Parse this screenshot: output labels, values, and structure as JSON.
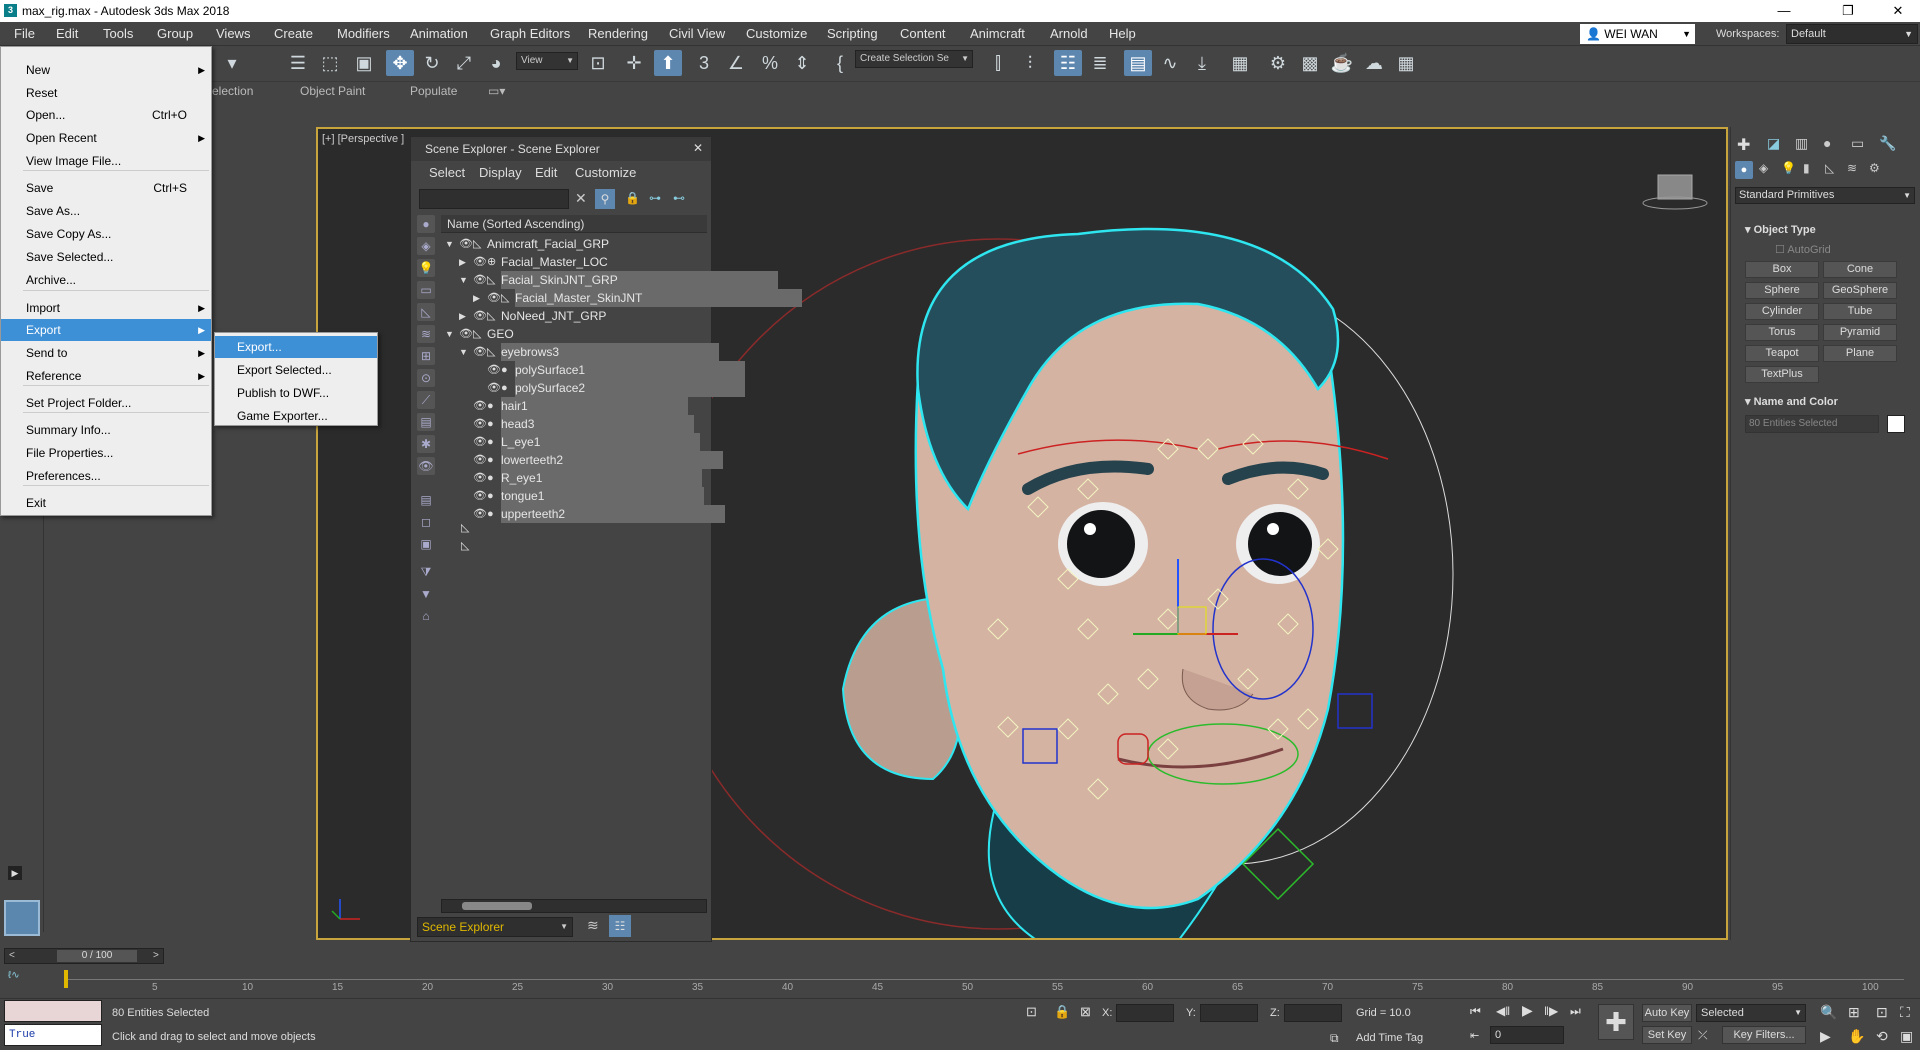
{
  "window": {
    "title": "max_rig.max - Autodesk 3ds Max 2018",
    "minimize": "—",
    "maximize": "❐",
    "close": "✕"
  },
  "menubar": [
    "File",
    "Edit",
    "Tools",
    "Group",
    "Views",
    "Create",
    "Modifiers",
    "Animation",
    "Graph Editors",
    "Rendering",
    "Civil View",
    "Customize",
    "Scripting",
    "Content",
    "Animcraft",
    "Arnold",
    "Help"
  ],
  "user": {
    "name": "WEI WAN"
  },
  "workspace": {
    "label": "Workspaces:",
    "value": "Default"
  },
  "toolbar": {
    "view_dropdown": "View",
    "selection_set": "Create Selection Se"
  },
  "ribbon": {
    "tab1": "election",
    "tab2": "Object Paint",
    "tab3": "Populate"
  },
  "file_menu": {
    "items": [
      {
        "label": "New",
        "shortcut": "",
        "submenu": true
      },
      {
        "label": "Reset",
        "shortcut": "",
        "submenu": false
      },
      {
        "label": "Open...",
        "shortcut": "Ctrl+O",
        "submenu": false
      },
      {
        "label": "Open Recent",
        "shortcut": "",
        "submenu": true
      },
      {
        "label": "View Image File...",
        "shortcut": "",
        "submenu": false
      },
      {
        "label": "Save",
        "shortcut": "Ctrl+S",
        "submenu": false
      },
      {
        "label": "Save As...",
        "shortcut": "",
        "submenu": false
      },
      {
        "label": "Save Copy As...",
        "shortcut": "",
        "submenu": false
      },
      {
        "label": "Save Selected...",
        "shortcut": "",
        "submenu": false
      },
      {
        "label": "Archive...",
        "shortcut": "",
        "submenu": false
      },
      {
        "label": "Import",
        "shortcut": "",
        "submenu": true
      },
      {
        "label": "Export",
        "shortcut": "",
        "submenu": true
      },
      {
        "label": "Send to",
        "shortcut": "",
        "submenu": true
      },
      {
        "label": "Reference",
        "shortcut": "",
        "submenu": true
      },
      {
        "label": "Set Project Folder...",
        "shortcut": "",
        "submenu": false
      },
      {
        "label": "Summary Info...",
        "shortcut": "",
        "submenu": false
      },
      {
        "label": "File Properties...",
        "shortcut": "",
        "submenu": false
      },
      {
        "label": "Preferences...",
        "shortcut": "",
        "submenu": false
      },
      {
        "label": "Exit",
        "shortcut": "",
        "submenu": false
      }
    ],
    "highlighted": "Export"
  },
  "export_submenu": [
    "Export...",
    "Export Selected...",
    "Publish to DWF...",
    "Game Exporter..."
  ],
  "viewport": {
    "label": "[+] [Perspective ]"
  },
  "scene_explorer": {
    "title": "Scene Explorer - Scene Explorer",
    "close": "✕",
    "menus": [
      "Select",
      "Display",
      "Edit",
      "Customize"
    ],
    "column_header": "Name (Sorted Ascending)",
    "rows": [
      {
        "label": "Animcraft_Facial_GRP",
        "depth": 0,
        "selected": false,
        "expander": "▼",
        "kind": "bone"
      },
      {
        "label": "Facial_Master_LOC",
        "depth": 1,
        "selected": false,
        "expander": "▶",
        "kind": "loc"
      },
      {
        "label": "Facial_SkinJNT_GRP",
        "depth": 1,
        "selected": true,
        "expander": "▼",
        "kind": "bone"
      },
      {
        "label": "Facial_Master_SkinJNT",
        "depth": 2,
        "selected": true,
        "expander": "▶",
        "kind": "bone"
      },
      {
        "label": "NoNeed_JNT_GRP",
        "depth": 1,
        "selected": false,
        "expander": "▶",
        "kind": "bone"
      },
      {
        "label": "GEO",
        "depth": 0,
        "selected": false,
        "expander": "▼",
        "kind": "bone"
      },
      {
        "label": "eyebrows3",
        "depth": 1,
        "selected": true,
        "expander": "▼",
        "kind": "bone"
      },
      {
        "label": "polySurface1",
        "depth": 2,
        "selected": true,
        "expander": "",
        "kind": "geo"
      },
      {
        "label": "polySurface2",
        "depth": 2,
        "selected": true,
        "expander": "",
        "kind": "geo"
      },
      {
        "label": "hair1",
        "depth": 1,
        "selected": true,
        "expander": "",
        "kind": "geo"
      },
      {
        "label": "head3",
        "depth": 1,
        "selected": true,
        "expander": "",
        "kind": "geo"
      },
      {
        "label": "L_eye1",
        "depth": 1,
        "selected": true,
        "expander": "",
        "kind": "geo"
      },
      {
        "label": "lowerteeth2",
        "depth": 1,
        "selected": true,
        "expander": "",
        "kind": "geo"
      },
      {
        "label": "R_eye1",
        "depth": 1,
        "selected": true,
        "expander": "",
        "kind": "geo"
      },
      {
        "label": "tongue1",
        "depth": 1,
        "selected": true,
        "expander": "",
        "kind": "geo"
      },
      {
        "label": "upperteeth2",
        "depth": 1,
        "selected": true,
        "expander": "",
        "kind": "geo"
      }
    ],
    "footer": "Scene Explorer"
  },
  "command_panel": {
    "dropdown": "Standard Primitives",
    "object_type": "Object Type",
    "autogrid": "AutoGrid",
    "buttons": [
      "Box",
      "Cone",
      "Sphere",
      "GeoSphere",
      "Cylinder",
      "Tube",
      "Torus",
      "Pyramid",
      "Teapot",
      "Plane",
      "TextPlus"
    ],
    "name_and_color": "Name and Color",
    "name_field": "80 Entities Selected"
  },
  "timeline": {
    "frame": "0 / 100",
    "ticks": [
      "5",
      "10",
      "15",
      "20",
      "25",
      "30",
      "35",
      "40",
      "45",
      "50",
      "55",
      "60",
      "65",
      "70",
      "75",
      "80",
      "85",
      "90",
      "95",
      "100"
    ]
  },
  "status": {
    "script_value": "True",
    "selected": "80 Entities Selected",
    "prompt": "Click and drag to select and move objects",
    "x_label": "X:",
    "y_label": "Y:",
    "z_label": "Z:",
    "grid": "Grid = 10.0",
    "add_time_tag": "Add Time Tag",
    "auto_key": "Auto Key",
    "set_key": "Set Key",
    "key_filter_value": "Selected",
    "key_filters": "Key Filters...",
    "current_frame": "0"
  },
  "colors": {
    "accent": "#3d8fd6",
    "viewport_border": "#c8a43c",
    "selection_cyan": "#2ee6f0"
  }
}
